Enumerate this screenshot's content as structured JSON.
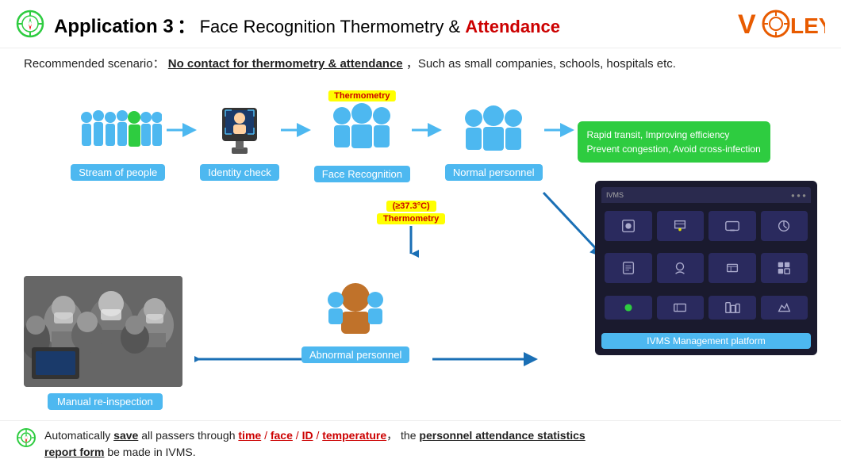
{
  "header": {
    "app_number": "Application 3",
    "colon": "：",
    "title_plain": "Face Recognition Thermometry & ",
    "title_red": "Attendance",
    "logo": "VCLEY"
  },
  "scenario": {
    "prefix": "Recommended scenario：",
    "highlight": "No contact for thermometry & attendance",
    "suffix": "，Such as small companies, schools, hospitals etc."
  },
  "flow": {
    "items": [
      {
        "label": "Stream of people"
      },
      {
        "label": "Identity check"
      },
      {
        "label": "Face Recognition"
      },
      {
        "label": "Normal personnel"
      }
    ],
    "thermometry_badge": "Thermometry",
    "green_box_line1": "Rapid transit, Improving efficiency",
    "green_box_line2": "Prevent congestion, Avoid cross-infection"
  },
  "bottom_flow": {
    "abnormal_label": "Abnormal personnel",
    "thermo_label": "Thermometry",
    "temp_label": "(≥37.3°C)",
    "manual_label": "Manual re-inspection",
    "ivms_label": "IVMS Management platform",
    "ivms_header": "IVMS"
  },
  "footer": {
    "prefix": "Automatically ",
    "save_bold": "save",
    "middle1": " all passers through ",
    "time": "time",
    "slash1": " / ",
    "face": "face",
    "slash2": " / ",
    "id": "ID",
    "slash3": " / ",
    "temperature": "temperature",
    "comma": "，",
    "the": "  the ",
    "personnel_stats": "personnel attendance statistics",
    "line2": "report form",
    "line2_suffix": " be made in IVMS."
  }
}
